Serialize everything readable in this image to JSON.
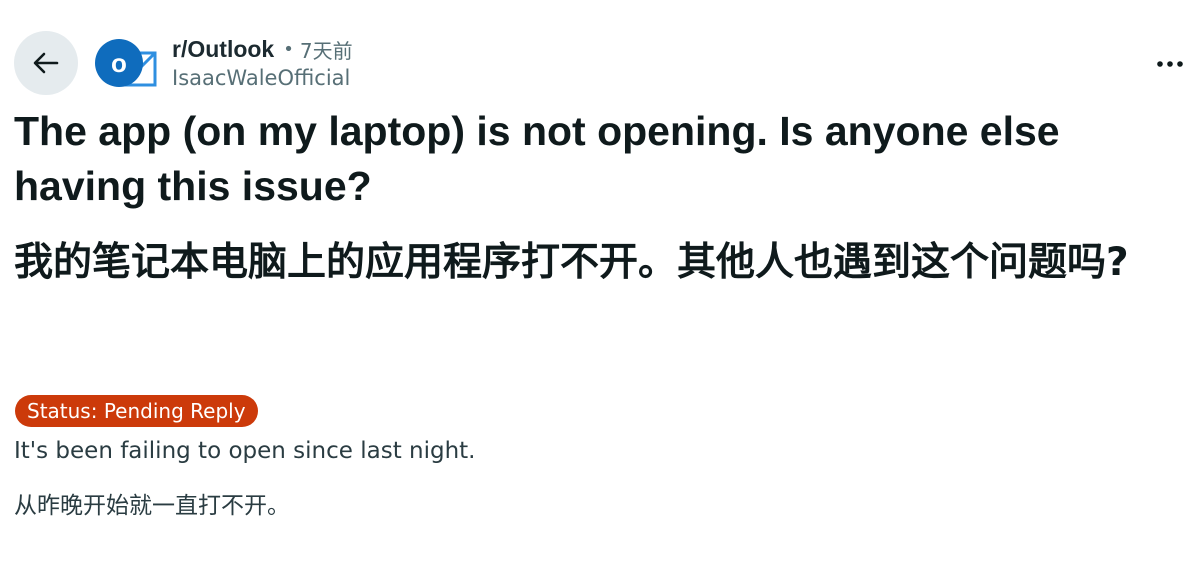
{
  "header": {
    "subreddit": "r/Outlook",
    "separator": "•",
    "time_ago": "7天前",
    "author": "IsaacWaleOfficial",
    "avatar_letter": "o"
  },
  "post": {
    "title_en": "The app (on my laptop) is not opening. Is anyone else having this issue?",
    "title_zh": "我的笔记本电脑上的应用程序打不开。其他人也遇到这个问题吗?",
    "flair": "Status: Pending Reply",
    "body_en": "It's been failing to open since last night.",
    "body_zh": "从昨晚开始就一直打不开。"
  },
  "icons": {
    "back": "arrow-left-icon",
    "more": "more-horizontal-icon",
    "subreddit_avatar": "outlook-logo-icon"
  },
  "colors": {
    "flair_bg": "#cc3a0a",
    "outlook_blue": "#0f6cbd",
    "back_button_bg": "#e5ebee"
  }
}
